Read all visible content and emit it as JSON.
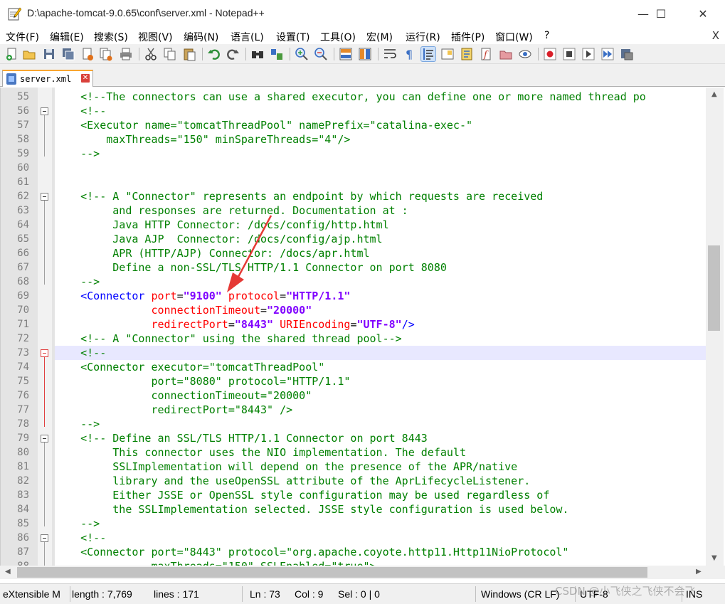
{
  "window": {
    "title": "D:\\apache-tomcat-9.0.65\\conf\\server.xml - Notepad++",
    "minimize": "—",
    "maximize": "☐",
    "close": "✕"
  },
  "menu": {
    "items": [
      "文件(F)",
      "编辑(E)",
      "搜索(S)",
      "视图(V)",
      "编码(N)",
      "语言(L)",
      "设置(T)",
      "工具(O)",
      "宏(M)",
      "运行(R)",
      "插件(P)",
      "窗口(W)",
      "?"
    ],
    "close_doc": "X"
  },
  "toolbar": {
    "icons": [
      "new-file-icon",
      "open-file-icon",
      "save-icon",
      "save-all-icon",
      "close-icon",
      "close-all-icon",
      "print-icon",
      "cut-icon",
      "copy-icon",
      "paste-icon",
      "undo-icon",
      "redo-icon",
      "find-icon",
      "replace-icon",
      "zoom-in-icon",
      "zoom-out-icon",
      "sync-vertical-icon",
      "sync-horizontal-icon",
      "word-wrap-icon",
      "show-all-chars-icon",
      "indent-guide-icon",
      "doc-map-icon",
      "function-list-icon",
      "folder-workspace-icon",
      "monitoring-icon",
      "record-macro-icon",
      "stop-macro-icon",
      "play-macro-icon",
      "run-macro-multiple-icon",
      "save-macro-icon"
    ]
  },
  "tab": {
    "label": "server.xml",
    "close": "✕"
  },
  "editor": {
    "current_line": 73,
    "lines": [
      {
        "n": "55",
        "parts": [
          {
            "c": "comment",
            "t": "    <!--The connectors can use a shared executor, you can define one or more named thread po"
          }
        ]
      },
      {
        "n": "56",
        "parts": [
          {
            "c": "comment",
            "t": "    <!--"
          }
        ]
      },
      {
        "n": "57",
        "parts": [
          {
            "c": "comment",
            "t": "    <Executor name=\"tomcatThreadPool\" namePrefix=\"catalina-exec-\""
          }
        ]
      },
      {
        "n": "58",
        "parts": [
          {
            "c": "comment",
            "t": "        maxThreads=\"150\" minSpareThreads=\"4\"/>"
          }
        ]
      },
      {
        "n": "59",
        "parts": [
          {
            "c": "comment",
            "t": "    -->"
          }
        ]
      },
      {
        "n": "60",
        "parts": [
          {
            "c": "plain",
            "t": ""
          }
        ]
      },
      {
        "n": "61",
        "parts": [
          {
            "c": "plain",
            "t": ""
          }
        ]
      },
      {
        "n": "62",
        "parts": [
          {
            "c": "comment",
            "t": "    <!-- A \"Connector\" represents an endpoint by which requests are received"
          }
        ]
      },
      {
        "n": "63",
        "parts": [
          {
            "c": "comment",
            "t": "         and responses are returned. Documentation at :"
          }
        ]
      },
      {
        "n": "64",
        "parts": [
          {
            "c": "comment",
            "t": "         Java HTTP Connector: /docs/config/http.html"
          }
        ]
      },
      {
        "n": "65",
        "parts": [
          {
            "c": "comment",
            "t": "         Java AJP  Connector: /docs/config/ajp.html"
          }
        ]
      },
      {
        "n": "66",
        "parts": [
          {
            "c": "comment",
            "t": "         APR (HTTP/AJP) Connector: /docs/apr.html"
          }
        ]
      },
      {
        "n": "67",
        "parts": [
          {
            "c": "comment",
            "t": "         Define a non-SSL/TLS HTTP/1.1 Connector on port 8080"
          }
        ]
      },
      {
        "n": "68",
        "parts": [
          {
            "c": "comment",
            "t": "    -->"
          }
        ]
      },
      {
        "n": "69",
        "parts": [
          {
            "c": "tag",
            "t": "    <Connector "
          },
          {
            "c": "attr",
            "t": "port"
          },
          {
            "c": "eq",
            "t": "="
          },
          {
            "c": "val",
            "t": "\"9100\""
          },
          {
            "c": "eq",
            "t": " "
          },
          {
            "c": "attr",
            "t": "protocol"
          },
          {
            "c": "eq",
            "t": "="
          },
          {
            "c": "val",
            "t": "\"HTTP/1.1\""
          }
        ]
      },
      {
        "n": "70",
        "parts": [
          {
            "c": "eq",
            "t": "               "
          },
          {
            "c": "attr",
            "t": "connectionTimeout"
          },
          {
            "c": "eq",
            "t": "="
          },
          {
            "c": "val",
            "t": "\"20000\""
          }
        ]
      },
      {
        "n": "71",
        "parts": [
          {
            "c": "eq",
            "t": "               "
          },
          {
            "c": "attr",
            "t": "redirectPort"
          },
          {
            "c": "eq",
            "t": "="
          },
          {
            "c": "val",
            "t": "\"8443\""
          },
          {
            "c": "eq",
            "t": " "
          },
          {
            "c": "attr",
            "t": "URIEncoding"
          },
          {
            "c": "eq",
            "t": "="
          },
          {
            "c": "val",
            "t": "\"UTF-8\""
          },
          {
            "c": "tag",
            "t": "/>"
          }
        ]
      },
      {
        "n": "72",
        "parts": [
          {
            "c": "comment",
            "t": "    <!-- A \"Connector\" using the shared thread pool-->"
          }
        ]
      },
      {
        "n": "73",
        "parts": [
          {
            "c": "comment",
            "t": "    <!--"
          }
        ]
      },
      {
        "n": "74",
        "parts": [
          {
            "c": "comment",
            "t": "    <Connector executor=\"tomcatThreadPool\""
          }
        ]
      },
      {
        "n": "75",
        "parts": [
          {
            "c": "comment",
            "t": "               port=\"8080\" protocol=\"HTTP/1.1\""
          }
        ]
      },
      {
        "n": "76",
        "parts": [
          {
            "c": "comment",
            "t": "               connectionTimeout=\"20000\""
          }
        ]
      },
      {
        "n": "77",
        "parts": [
          {
            "c": "comment",
            "t": "               redirectPort=\"8443\" />"
          }
        ]
      },
      {
        "n": "78",
        "parts": [
          {
            "c": "comment",
            "t": "    -->"
          }
        ]
      },
      {
        "n": "79",
        "parts": [
          {
            "c": "comment",
            "t": "    <!-- Define an SSL/TLS HTTP/1.1 Connector on port 8443"
          }
        ]
      },
      {
        "n": "80",
        "parts": [
          {
            "c": "comment",
            "t": "         This connector uses the NIO implementation. The default"
          }
        ]
      },
      {
        "n": "81",
        "parts": [
          {
            "c": "comment",
            "t": "         SSLImplementation will depend on the presence of the APR/native"
          }
        ]
      },
      {
        "n": "82",
        "parts": [
          {
            "c": "comment",
            "t": "         library and the useOpenSSL attribute of the AprLifecycleListener."
          }
        ]
      },
      {
        "n": "83",
        "parts": [
          {
            "c": "comment",
            "t": "         Either JSSE or OpenSSL style configuration may be used regardless of"
          }
        ]
      },
      {
        "n": "84",
        "parts": [
          {
            "c": "comment",
            "t": "         the SSLImplementation selected. JSSE style configuration is used below."
          }
        ]
      },
      {
        "n": "85",
        "parts": [
          {
            "c": "comment",
            "t": "    -->"
          }
        ]
      },
      {
        "n": "86",
        "parts": [
          {
            "c": "comment",
            "t": "    <!--"
          }
        ]
      },
      {
        "n": "87",
        "parts": [
          {
            "c": "comment",
            "t": "    <Connector port=\"8443\" protocol=\"org.apache.coyote.http11.Http11NioProtocol\""
          }
        ]
      },
      {
        "n": "88",
        "parts": [
          {
            "c": "comment",
            "t": "               maxThreads=\"150\" SSLEnabled=\"true\">"
          }
        ]
      }
    ],
    "fold_markers": [
      "56",
      "62",
      "73",
      "79",
      "86"
    ]
  },
  "status": {
    "type": "eXtensible M",
    "length": "length : 7,769",
    "lines": "lines : 171",
    "ln": "Ln : 73",
    "col": "Col : 9",
    "sel": "Sel : 0 | 0",
    "eol": "Windows (CR LF)",
    "encoding": "UTF-8",
    "mode": "INS"
  },
  "watermark": "CSDN @小飞侠之飞侠不会飞",
  "colors": {
    "comment": "#008000",
    "tag": "#0000ff",
    "attribute": "#ff0000",
    "value": "#8000ff",
    "current_line": "#e8e8ff",
    "annotation_arrow": "#e53935"
  }
}
